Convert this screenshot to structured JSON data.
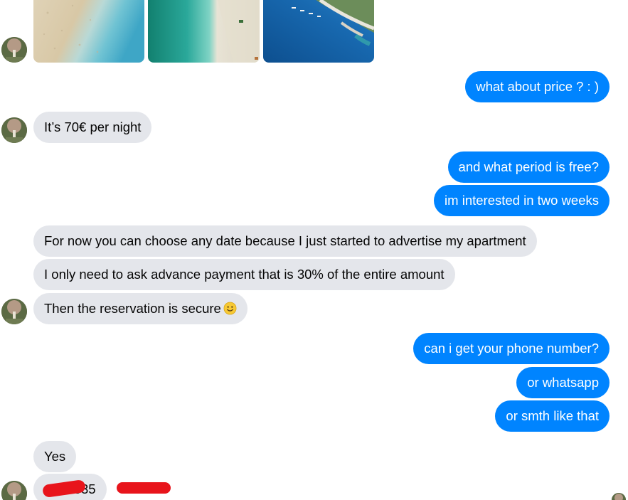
{
  "conversation": {
    "images": [
      {
        "name": "beach-sand-photo",
        "colors": [
          "#d9cbb0",
          "#8fd0d8",
          "#3aa5c4"
        ]
      },
      {
        "name": "beach-aerial-photo",
        "colors": [
          "#1b8f7a",
          "#3fb9b0",
          "#e7e1d2"
        ]
      },
      {
        "name": "harbor-photo",
        "colors": [
          "#0f5fa6",
          "#1e7cc4",
          "#e3e0d6"
        ]
      }
    ],
    "messages": [
      {
        "side": "out",
        "text": "what about price ?  : )"
      },
      {
        "side": "in",
        "text": "It’s 70€ per night"
      },
      {
        "side": "out",
        "text": "and what period is free?"
      },
      {
        "side": "out",
        "text": "im interested in two weeks"
      },
      {
        "side": "in",
        "text": "For now you can choose any date because I just started to advertise my apartment"
      },
      {
        "side": "in",
        "text": "I only need to ask advance payment that is 30% of the entire amount"
      },
      {
        "side": "in",
        "text": "Then the reservation is secure",
        "emoji": "slightly-smiling-face"
      },
      {
        "side": "out",
        "text": "can i get your phone number?"
      },
      {
        "side": "out",
        "text": "or whatsapp"
      },
      {
        "side": "out",
        "text": "or smth like that"
      },
      {
        "side": "in",
        "text": "Yes"
      },
      {
        "side": "in",
        "text": "+  99 335",
        "redacted": true
      }
    ]
  },
  "colors": {
    "incoming_bubble": "#e4e6eb",
    "outgoing_bubble": "#0084ff",
    "redaction": "#e8141b"
  }
}
